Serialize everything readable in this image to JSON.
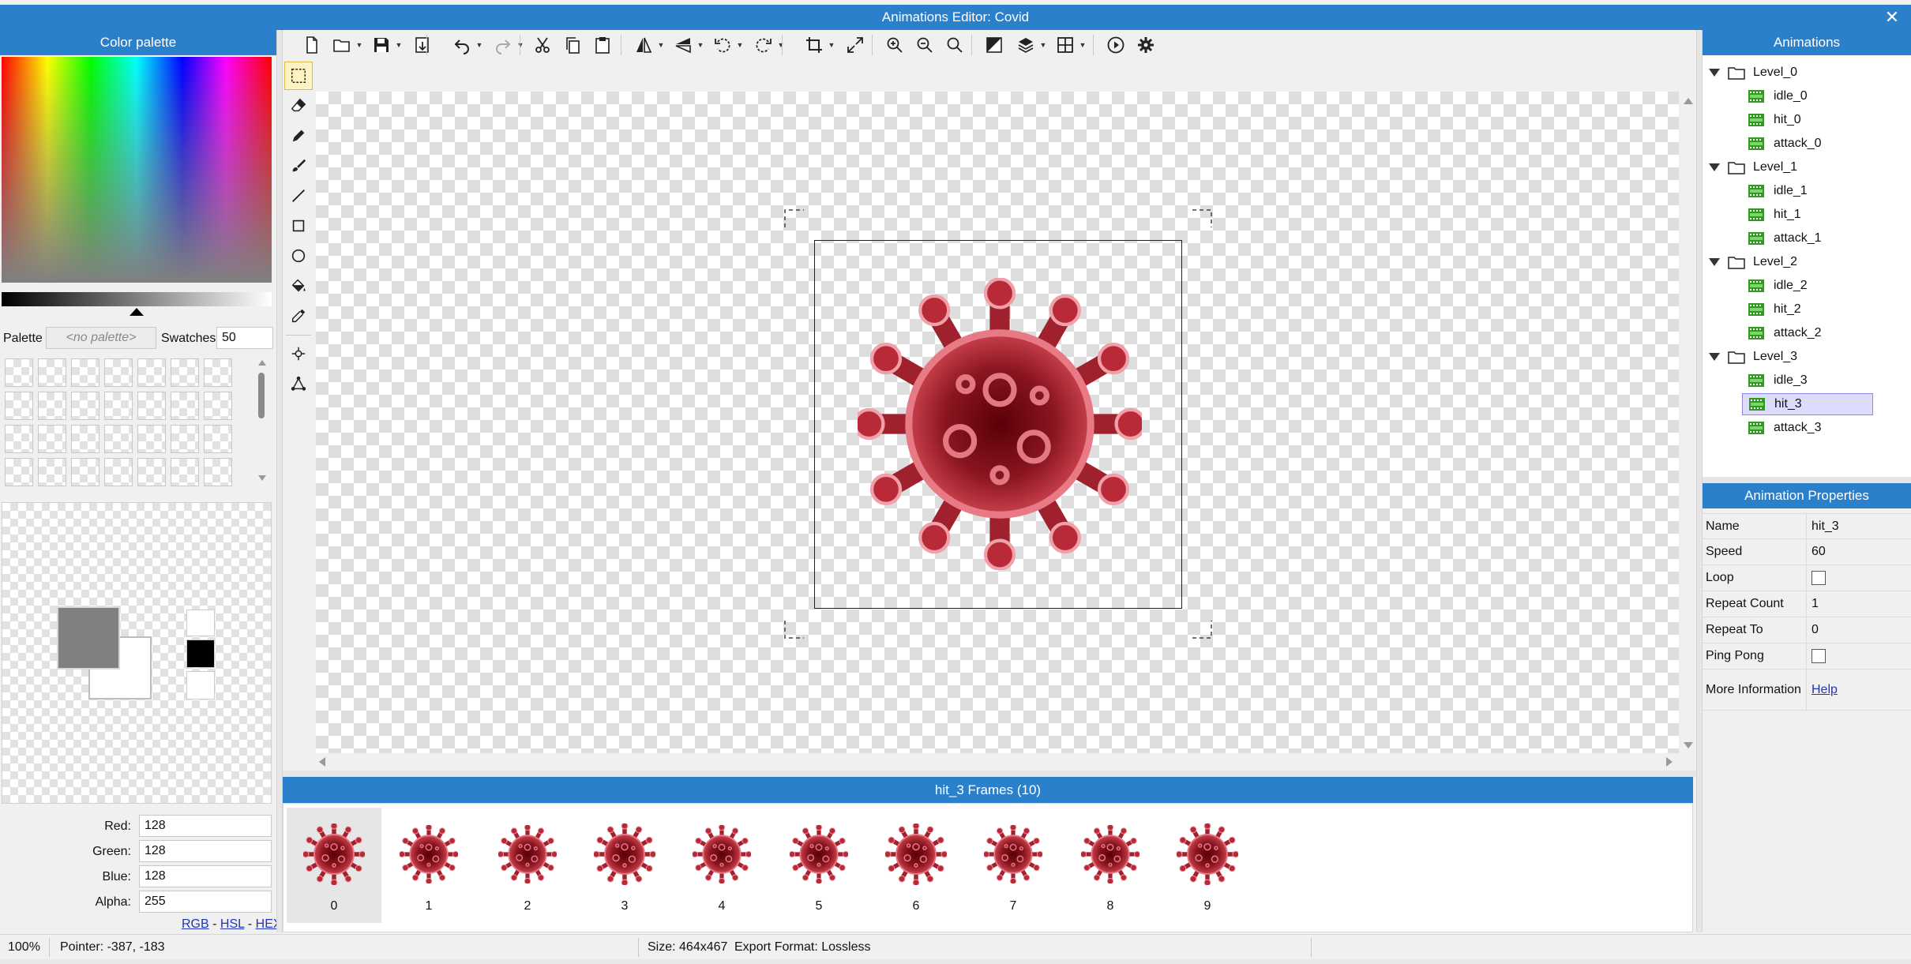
{
  "window": {
    "title": "Animations Editor: Covid",
    "close_glyph": "✕"
  },
  "color_palette": {
    "title": "Color palette",
    "palette_label": "Palette",
    "palette_value": "<no palette>",
    "swatches_label": "Swatches",
    "swatches_value": "50",
    "red_label": "Red:",
    "red": "128",
    "green_label": "Green:",
    "green": "128",
    "blue_label": "Blue:",
    "blue": "128",
    "alpha_label": "Alpha:",
    "alpha": "255",
    "link_rgb": "RGB",
    "link_sep1": " - ",
    "link_hsl": "HSL",
    "link_sep2": " - ",
    "link_hex": "HEX",
    "primary_color": "#808080",
    "secondary_color": "#ffffff"
  },
  "toolbar": [
    "new-file-icon",
    "open-folder-icon",
    "save-icon",
    "export-icon",
    "undo-icon",
    "redo-icon",
    "cut-icon",
    "copy-icon",
    "paste-icon",
    "flip-horizontal-icon",
    "flip-vertical-icon",
    "rotate-left-icon",
    "rotate-right-icon",
    "crop-icon",
    "resize-icon",
    "zoom-in-icon",
    "zoom-out-icon",
    "zoom-reset-icon",
    "invert-icon",
    "layers-icon",
    "grid-icon",
    "play-icon",
    "settings-icon"
  ],
  "tools": [
    "rectangle-select-icon",
    "eraser-icon",
    "pencil-icon",
    "brush-icon",
    "line-icon",
    "rectangle-icon",
    "ellipse-icon",
    "fill-bucket-icon",
    "eyedropper-icon",
    "pivot-icon",
    "bone-icon"
  ],
  "animations": {
    "title": "Animations",
    "tree": [
      {
        "folder": "Level_0",
        "items": [
          "idle_0",
          "hit_0",
          "attack_0"
        ]
      },
      {
        "folder": "Level_1",
        "items": [
          "idle_1",
          "hit_1",
          "attack_1"
        ]
      },
      {
        "folder": "Level_2",
        "items": [
          "idle_2",
          "hit_2",
          "attack_2"
        ]
      },
      {
        "folder": "Level_3",
        "items": [
          "idle_3",
          "hit_3",
          "attack_3"
        ]
      }
    ],
    "selected": "hit_3"
  },
  "properties": {
    "title": "Animation Properties",
    "name_label": "Name",
    "name": "hit_3",
    "speed_label": "Speed",
    "speed": "60",
    "loop_label": "Loop",
    "loop": false,
    "repeat_count_label": "Repeat Count",
    "repeat_count": "1",
    "repeat_to_label": "Repeat To",
    "repeat_to": "0",
    "ping_pong_label": "Ping Pong",
    "ping_pong": false,
    "more_info_label": "More Information",
    "help_link": "Help"
  },
  "frames": {
    "title": "hit_3 Frames (10)",
    "labels": [
      "0",
      "1",
      "2",
      "3",
      "4",
      "5",
      "6",
      "7",
      "8",
      "9"
    ],
    "selected_index": 0
  },
  "status": {
    "zoom": "100%",
    "pointer": "Pointer: -387, -183",
    "size": "Size: 464x467",
    "export_format": "Export Format: Lossless"
  }
}
